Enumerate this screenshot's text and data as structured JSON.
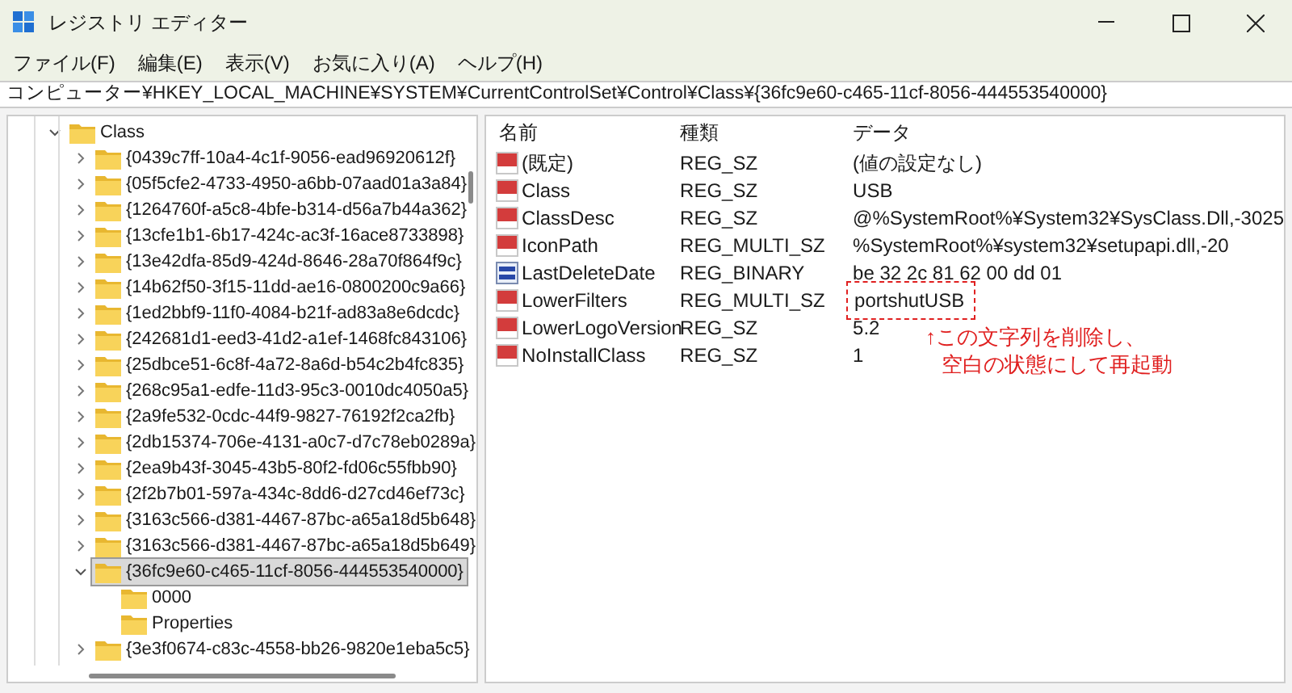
{
  "window": {
    "title": "レジストリ エディター"
  },
  "menu": [
    "ファイル(F)",
    "編集(E)",
    "表示(V)",
    "お気に入り(A)",
    "ヘルプ(H)"
  ],
  "address": "コンピューター¥HKEY_LOCAL_MACHINE¥SYSTEM¥CurrentControlSet¥Control¥Class¥{36fc9e60-c465-11cf-8056-444553540000}",
  "tree": {
    "label": "Class",
    "expanded": true,
    "children": [
      {
        "label": "{0439c7ff-10a4-4c1f-9056-ead96920612f}",
        "expanded": false,
        "selected": false
      },
      {
        "label": "{05f5cfe2-4733-4950-a6bb-07aad01a3a84}",
        "expanded": false,
        "selected": false
      },
      {
        "label": "{1264760f-a5c8-4bfe-b314-d56a7b44a362}",
        "expanded": false,
        "selected": false
      },
      {
        "label": "{13cfe1b1-6b17-424c-ac3f-16ace8733898}",
        "expanded": false,
        "selected": false
      },
      {
        "label": "{13e42dfa-85d9-424d-8646-28a70f864f9c}",
        "expanded": false,
        "selected": false
      },
      {
        "label": "{14b62f50-3f15-11dd-ae16-0800200c9a66}",
        "expanded": false,
        "selected": false
      },
      {
        "label": "{1ed2bbf9-11f0-4084-b21f-ad83a8e6dcdc}",
        "expanded": false,
        "selected": false
      },
      {
        "label": "{242681d1-eed3-41d2-a1ef-1468fc843106}",
        "expanded": false,
        "selected": false
      },
      {
        "label": "{25dbce51-6c8f-4a72-8a6d-b54c2b4fc835}",
        "expanded": false,
        "selected": false
      },
      {
        "label": "{268c95a1-edfe-11d3-95c3-0010dc4050a5}",
        "expanded": false,
        "selected": false
      },
      {
        "label": "{2a9fe532-0cdc-44f9-9827-76192f2ca2fb}",
        "expanded": false,
        "selected": false
      },
      {
        "label": "{2db15374-706e-4131-a0c7-d7c78eb0289a}",
        "expanded": false,
        "selected": false
      },
      {
        "label": "{2ea9b43f-3045-43b5-80f2-fd06c55fbb90}",
        "expanded": false,
        "selected": false
      },
      {
        "label": "{2f2b7b01-597a-434c-8dd6-d27cd46ef73c}",
        "expanded": false,
        "selected": false
      },
      {
        "label": "{3163c566-d381-4467-87bc-a65a18d5b648}",
        "expanded": false,
        "selected": false
      },
      {
        "label": "{3163c566-d381-4467-87bc-a65a18d5b649}",
        "expanded": false,
        "selected": false
      },
      {
        "label": "{36fc9e60-c465-11cf-8056-444553540000}",
        "expanded": true,
        "selected": true,
        "children": [
          {
            "label": "0000"
          },
          {
            "label": "Properties"
          }
        ]
      },
      {
        "label": "{3e3f0674-c83c-4558-bb26-9820e1eba5c5}",
        "expanded": false,
        "selected": false
      }
    ]
  },
  "columns": [
    "名前",
    "種類",
    "データ"
  ],
  "values": [
    {
      "kind": "string",
      "name": "(既定)",
      "type": "REG_SZ",
      "data": "(値の設定なし)",
      "highlighted": false
    },
    {
      "kind": "string",
      "name": "Class",
      "type": "REG_SZ",
      "data": "USB",
      "highlighted": false
    },
    {
      "kind": "string",
      "name": "ClassDesc",
      "type": "REG_SZ",
      "data": "@%SystemRoot%¥System32¥SysClass.Dll,-3025",
      "highlighted": false
    },
    {
      "kind": "string",
      "name": "IconPath",
      "type": "REG_MULTI_SZ",
      "data": "%SystemRoot%¥system32¥setupapi.dll,-20",
      "highlighted": false
    },
    {
      "kind": "binary",
      "name": "LastDeleteDate",
      "type": "REG_BINARY",
      "data": "be 32 2c 81 62 00 dd 01",
      "highlighted": false
    },
    {
      "kind": "string",
      "name": "LowerFilters",
      "type": "REG_MULTI_SZ",
      "data": "portshutUSB",
      "highlighted": true
    },
    {
      "kind": "string",
      "name": "LowerLogoVersion",
      "type": "REG_SZ",
      "data": "5.2",
      "highlighted": false
    },
    {
      "kind": "string",
      "name": "NoInstallClass",
      "type": "REG_SZ",
      "data": "1",
      "highlighted": false
    }
  ],
  "annotation": [
    "↑この文字列を削除し、",
    "空白の状態にして再起動"
  ]
}
